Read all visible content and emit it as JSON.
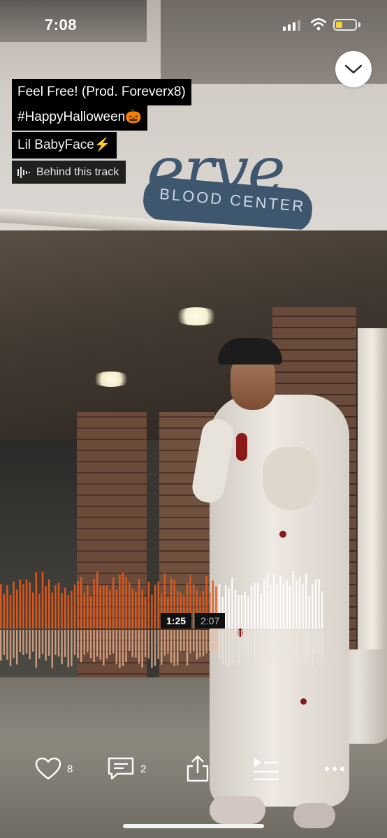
{
  "status_bar": {
    "time": "7:08",
    "battery_level": 0.35,
    "battery_color": "#f2d13a"
  },
  "track": {
    "title_line1": "Feel Free! (Prod. Foreverx8)",
    "title_line2": "#HappyHalloween🎃",
    "artist": "Lil BabyFace⚡",
    "behind_label": "Behind this track"
  },
  "background": {
    "sign_text": "erve",
    "sign_subtext": "BLOOD CENTER"
  },
  "player": {
    "current_time": "1:25",
    "total_time": "2:07",
    "progress": 0.669,
    "played_color": "#e35b1c",
    "unplayed_color": "#ffffff"
  },
  "actions": {
    "likes": "8",
    "comments": "2"
  },
  "icons": {
    "collapse": "chevron-down-icon",
    "like": "heart-icon",
    "comment": "comment-icon",
    "share": "share-icon",
    "queue": "play-next-icon",
    "more": "more-icon",
    "waveform": "waveform-icon"
  }
}
